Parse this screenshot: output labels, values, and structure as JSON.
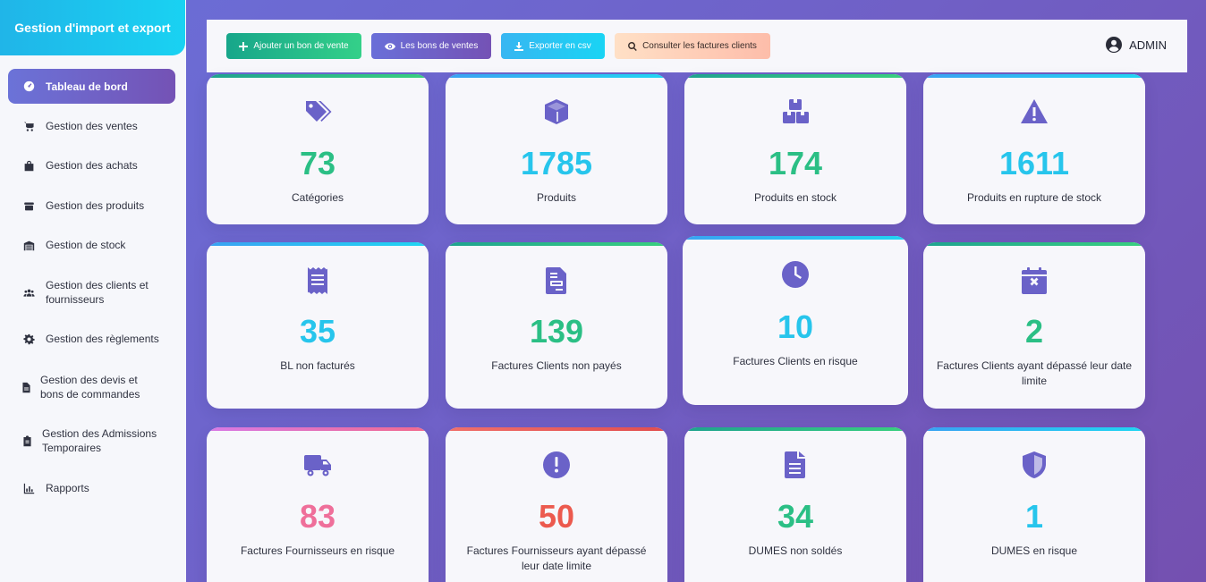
{
  "app": {
    "brand": "Gestion d'import et export"
  },
  "sidebar": {
    "items": [
      {
        "label": "Tableau de bord",
        "icon": "dashboard-icon",
        "active": true
      },
      {
        "label": "Gestion des ventes",
        "icon": "cart-icon"
      },
      {
        "label": "Gestion des achats",
        "icon": "bag-icon"
      },
      {
        "label": "Gestion des produits",
        "icon": "box-icon"
      },
      {
        "label": "Gestion de stock",
        "icon": "warehouse-icon"
      },
      {
        "label": "Gestion des clients et fournisseurs",
        "icon": "users-icon"
      },
      {
        "label": "Gestion des règlements",
        "icon": "gear-icon"
      },
      {
        "label": "Gestion des devis et bons de commandes",
        "icon": "document-icon"
      },
      {
        "label": "Gestion des Admissions Temporaires",
        "icon": "clipboard-icon"
      },
      {
        "label": "Rapports",
        "icon": "chart-icon"
      }
    ]
  },
  "toolbar": {
    "add_sale": "Ajouter un bon de vente",
    "view_sales": "Les bons de ventes",
    "export_csv": "Exporter en csv",
    "view_invoices": "Consulter les factures clients",
    "user": "ADMIN"
  },
  "cards": [
    {
      "value": "73",
      "label": "Catégories",
      "color": "#2bbf85",
      "icon": "tags-icon"
    },
    {
      "value": "1785",
      "label": "Produits",
      "color": "#27c5ec",
      "icon": "cube-icon"
    },
    {
      "value": "174",
      "label": "Produits en stock",
      "color": "#2bbf85",
      "icon": "boxes-icon"
    },
    {
      "value": "1611",
      "label": "Produits en rupture de stock",
      "color": "#27c5ec",
      "icon": "warning-icon"
    },
    {
      "value": "35",
      "label": "BL non facturés",
      "color": "#27c5ec",
      "icon": "receipt-icon"
    },
    {
      "value": "139",
      "label": "Factures Clients non payés",
      "color": "#2bbf85",
      "icon": "invoice-icon"
    },
    {
      "value": "10",
      "label": "Factures Clients en risque",
      "color": "#27c5ec",
      "icon": "clock-icon"
    },
    {
      "value": "2",
      "label": "Factures Clients ayant dépassé leur date limite",
      "color": "#2bbf85",
      "icon": "calendar-x-icon"
    },
    {
      "value": "83",
      "label": "Factures Fournisseurs en risque",
      "color": "#ef6f9a",
      "icon": "truck-icon"
    },
    {
      "value": "50",
      "label": "Factures Fournisseurs ayant dépassé leur date limite",
      "color": "#ec5a4e",
      "icon": "exclamation-icon"
    },
    {
      "value": "34",
      "label": "DUMES non soldés",
      "color": "#2bbf85",
      "icon": "file-lines-icon"
    },
    {
      "value": "1",
      "label": "DUMES en risque",
      "color": "#27c5ec",
      "icon": "shield-icon"
    }
  ]
}
